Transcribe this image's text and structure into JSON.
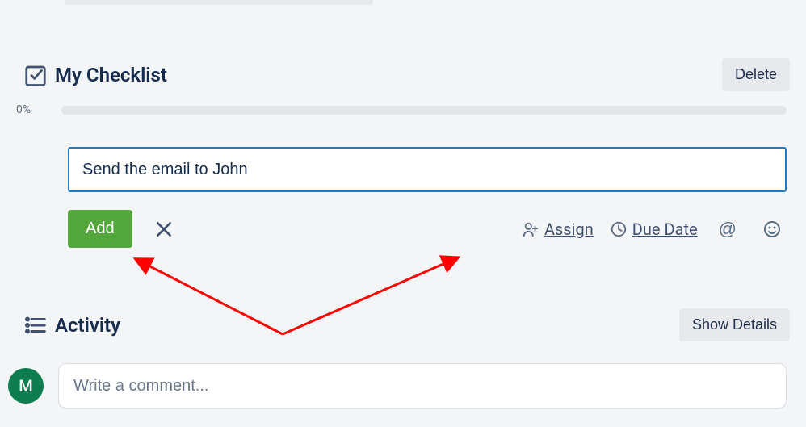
{
  "checklist": {
    "title": "My Checklist",
    "delete_label": "Delete",
    "progress_percent": "0%",
    "new_item_value": "Send the email to John",
    "add_label": "Add",
    "assign_label": "Assign",
    "due_date_label": "Due Date"
  },
  "activity": {
    "title": "Activity",
    "show_details_label": "Show Details",
    "avatar_initial": "M",
    "comment_placeholder": "Write a comment..."
  }
}
